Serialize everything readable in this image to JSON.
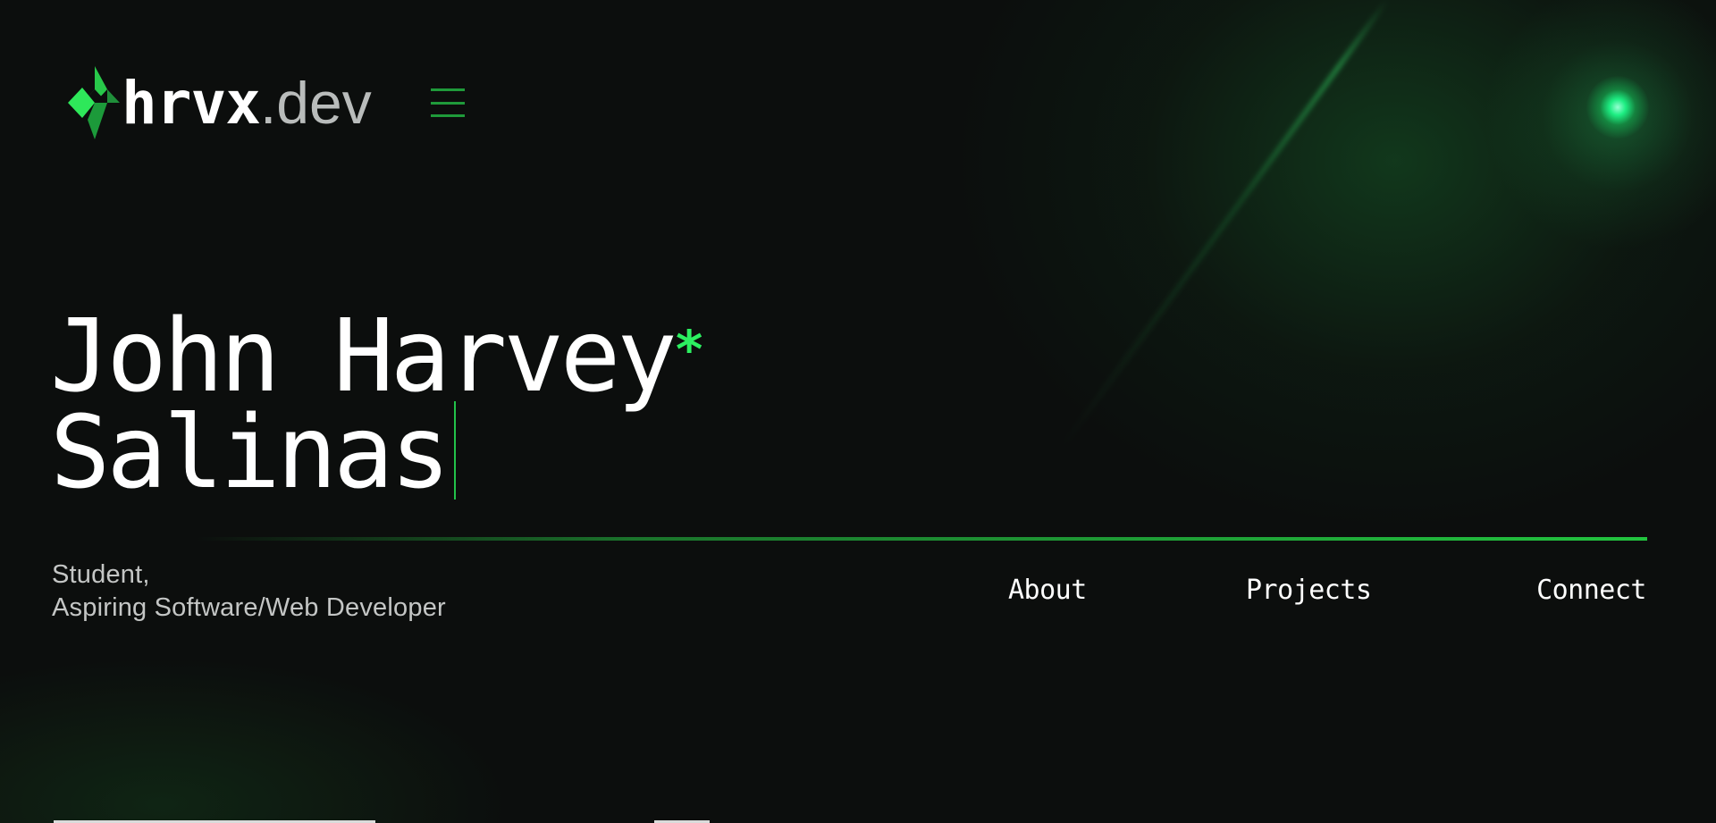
{
  "brand": {
    "main": "hrvx",
    "sub": ".dev",
    "logo_icon": "diamond-logo-icon",
    "accent_color": "#22c43f"
  },
  "header": {
    "menu_icon": "hamburger-menu-icon"
  },
  "hero": {
    "first_line": "John Harvey",
    "asterisk": "*",
    "second_line": "Salinas"
  },
  "tagline": {
    "line1": "Student,",
    "line2": "Aspiring Software/Web Developer"
  },
  "nav": {
    "about": "About",
    "projects": "Projects",
    "connect": "Connect"
  }
}
